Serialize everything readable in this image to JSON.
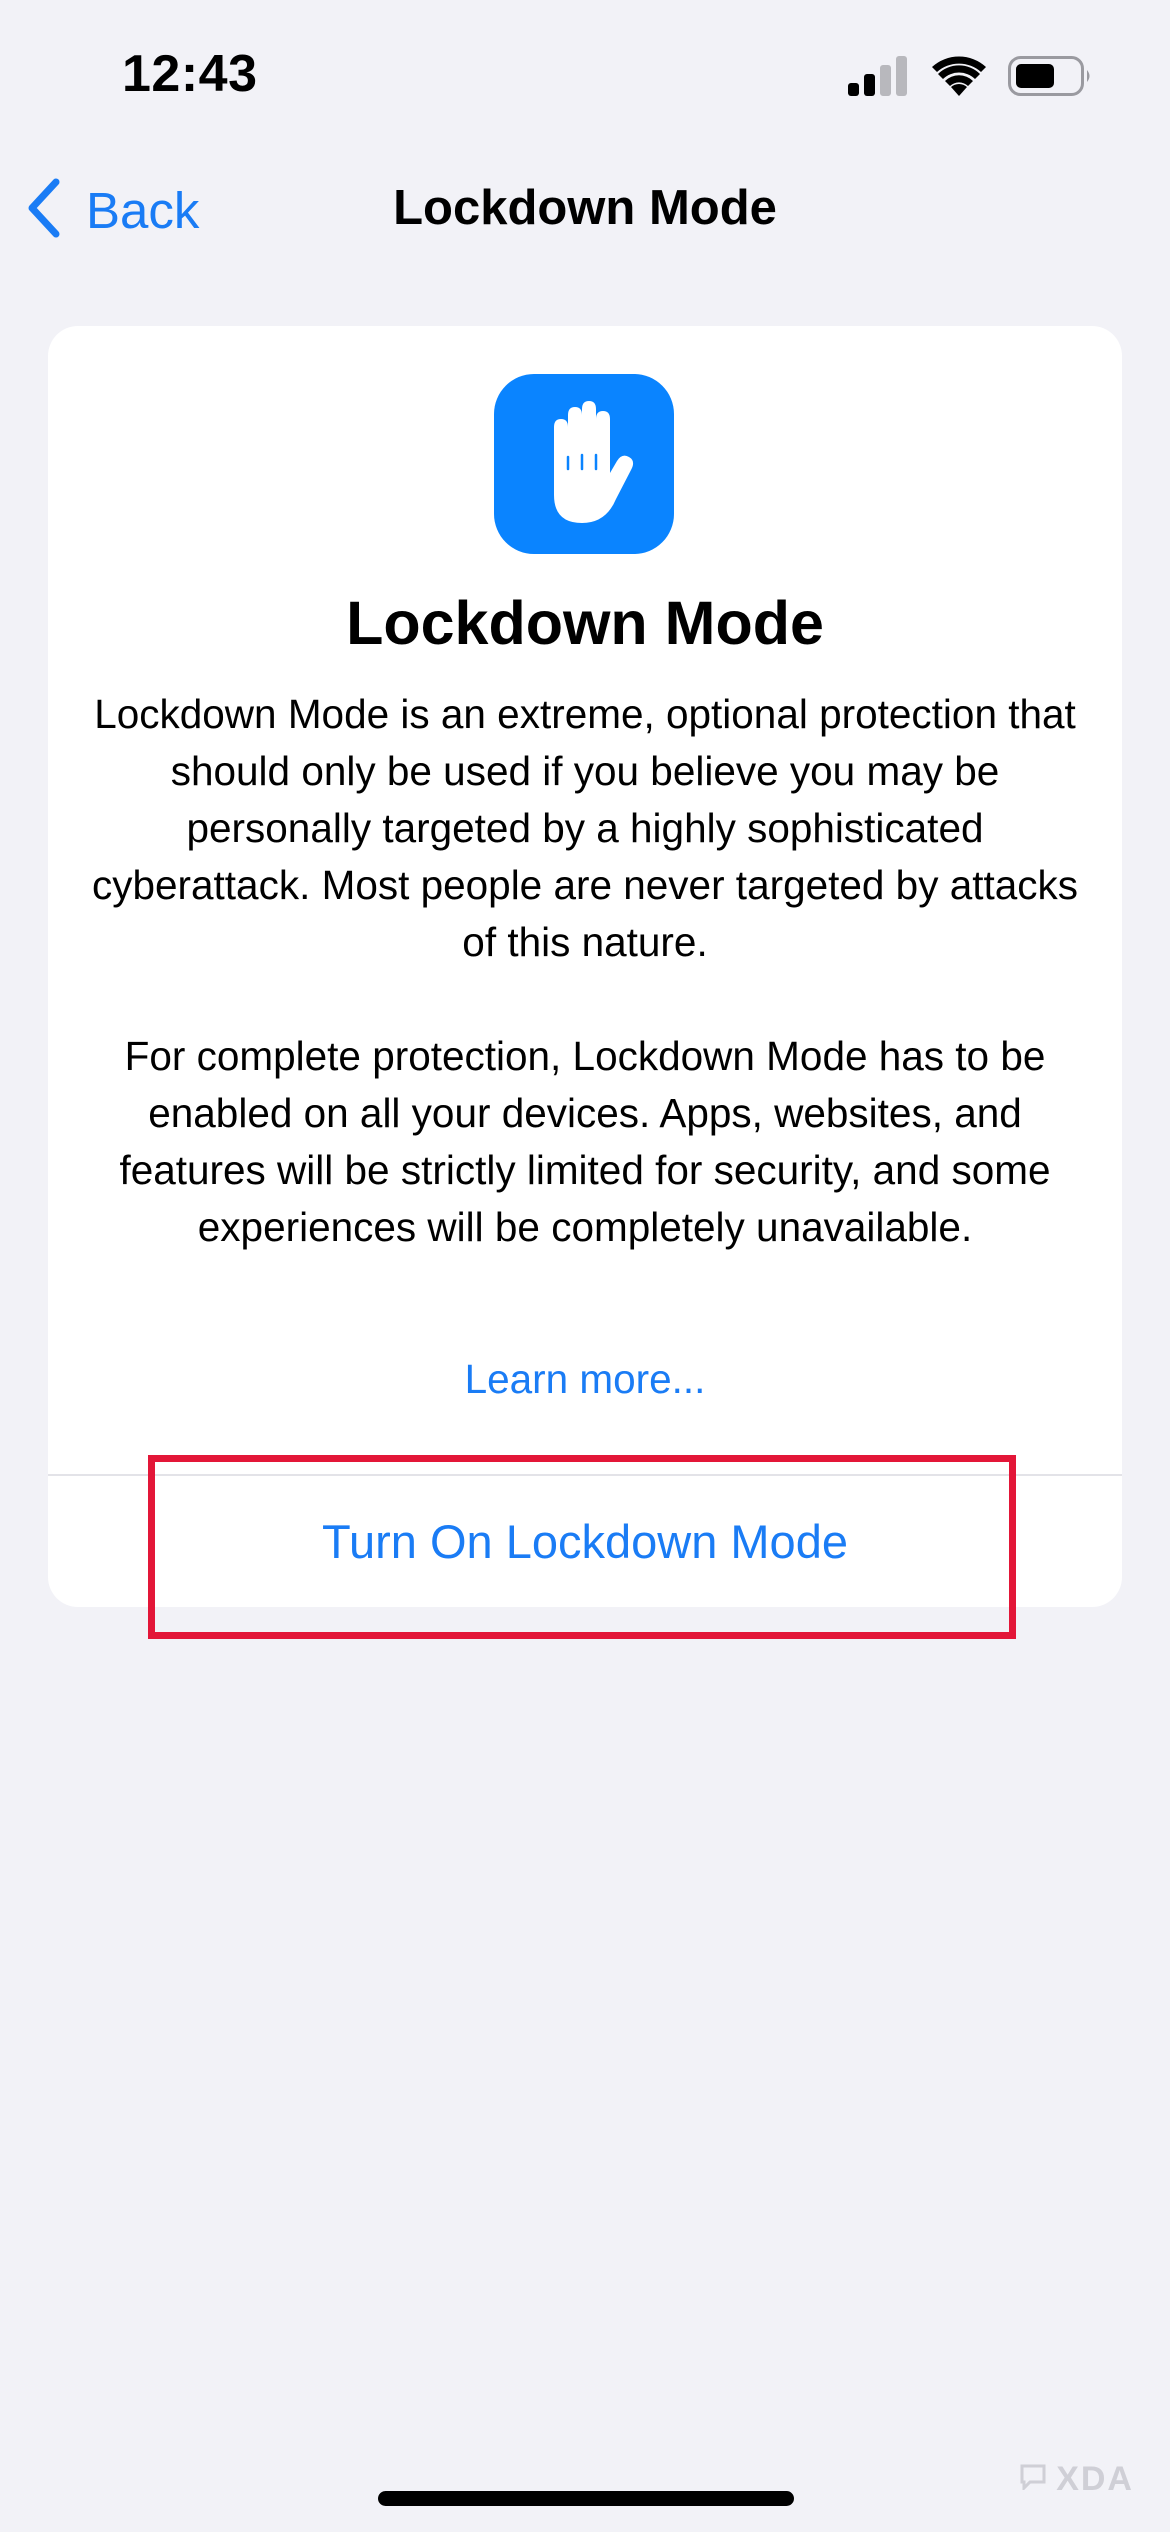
{
  "status_bar": {
    "time": "12:43",
    "signal_icon": "cellular-signal-icon",
    "wifi_icon": "wifi-icon",
    "battery_icon": "battery-icon"
  },
  "nav": {
    "back_label": "Back",
    "title": "Lockdown Mode"
  },
  "card": {
    "icon": "raised-hand-icon",
    "title": "Lockdown Mode",
    "paragraph_1": "Lockdown Mode is an extreme, optional protection that should only be used if you believe you may be personally targeted by a highly sophisticated cyberattack. Most people are never targeted by attacks of this nature.",
    "paragraph_2": "For complete protection, Lockdown Mode has to be enabled on all your devices. Apps, websites, and features will be strictly limited for security, and some experiences will be completely unavailable.",
    "learn_more": "Learn more...",
    "action_label": "Turn On Lockdown Mode"
  },
  "watermark": {
    "text": "XDA"
  },
  "colors": {
    "accent": "#1a7cf5",
    "icon_background": "#0a84ff",
    "highlight": "#e31638",
    "page_background": "#f2f2f7"
  }
}
